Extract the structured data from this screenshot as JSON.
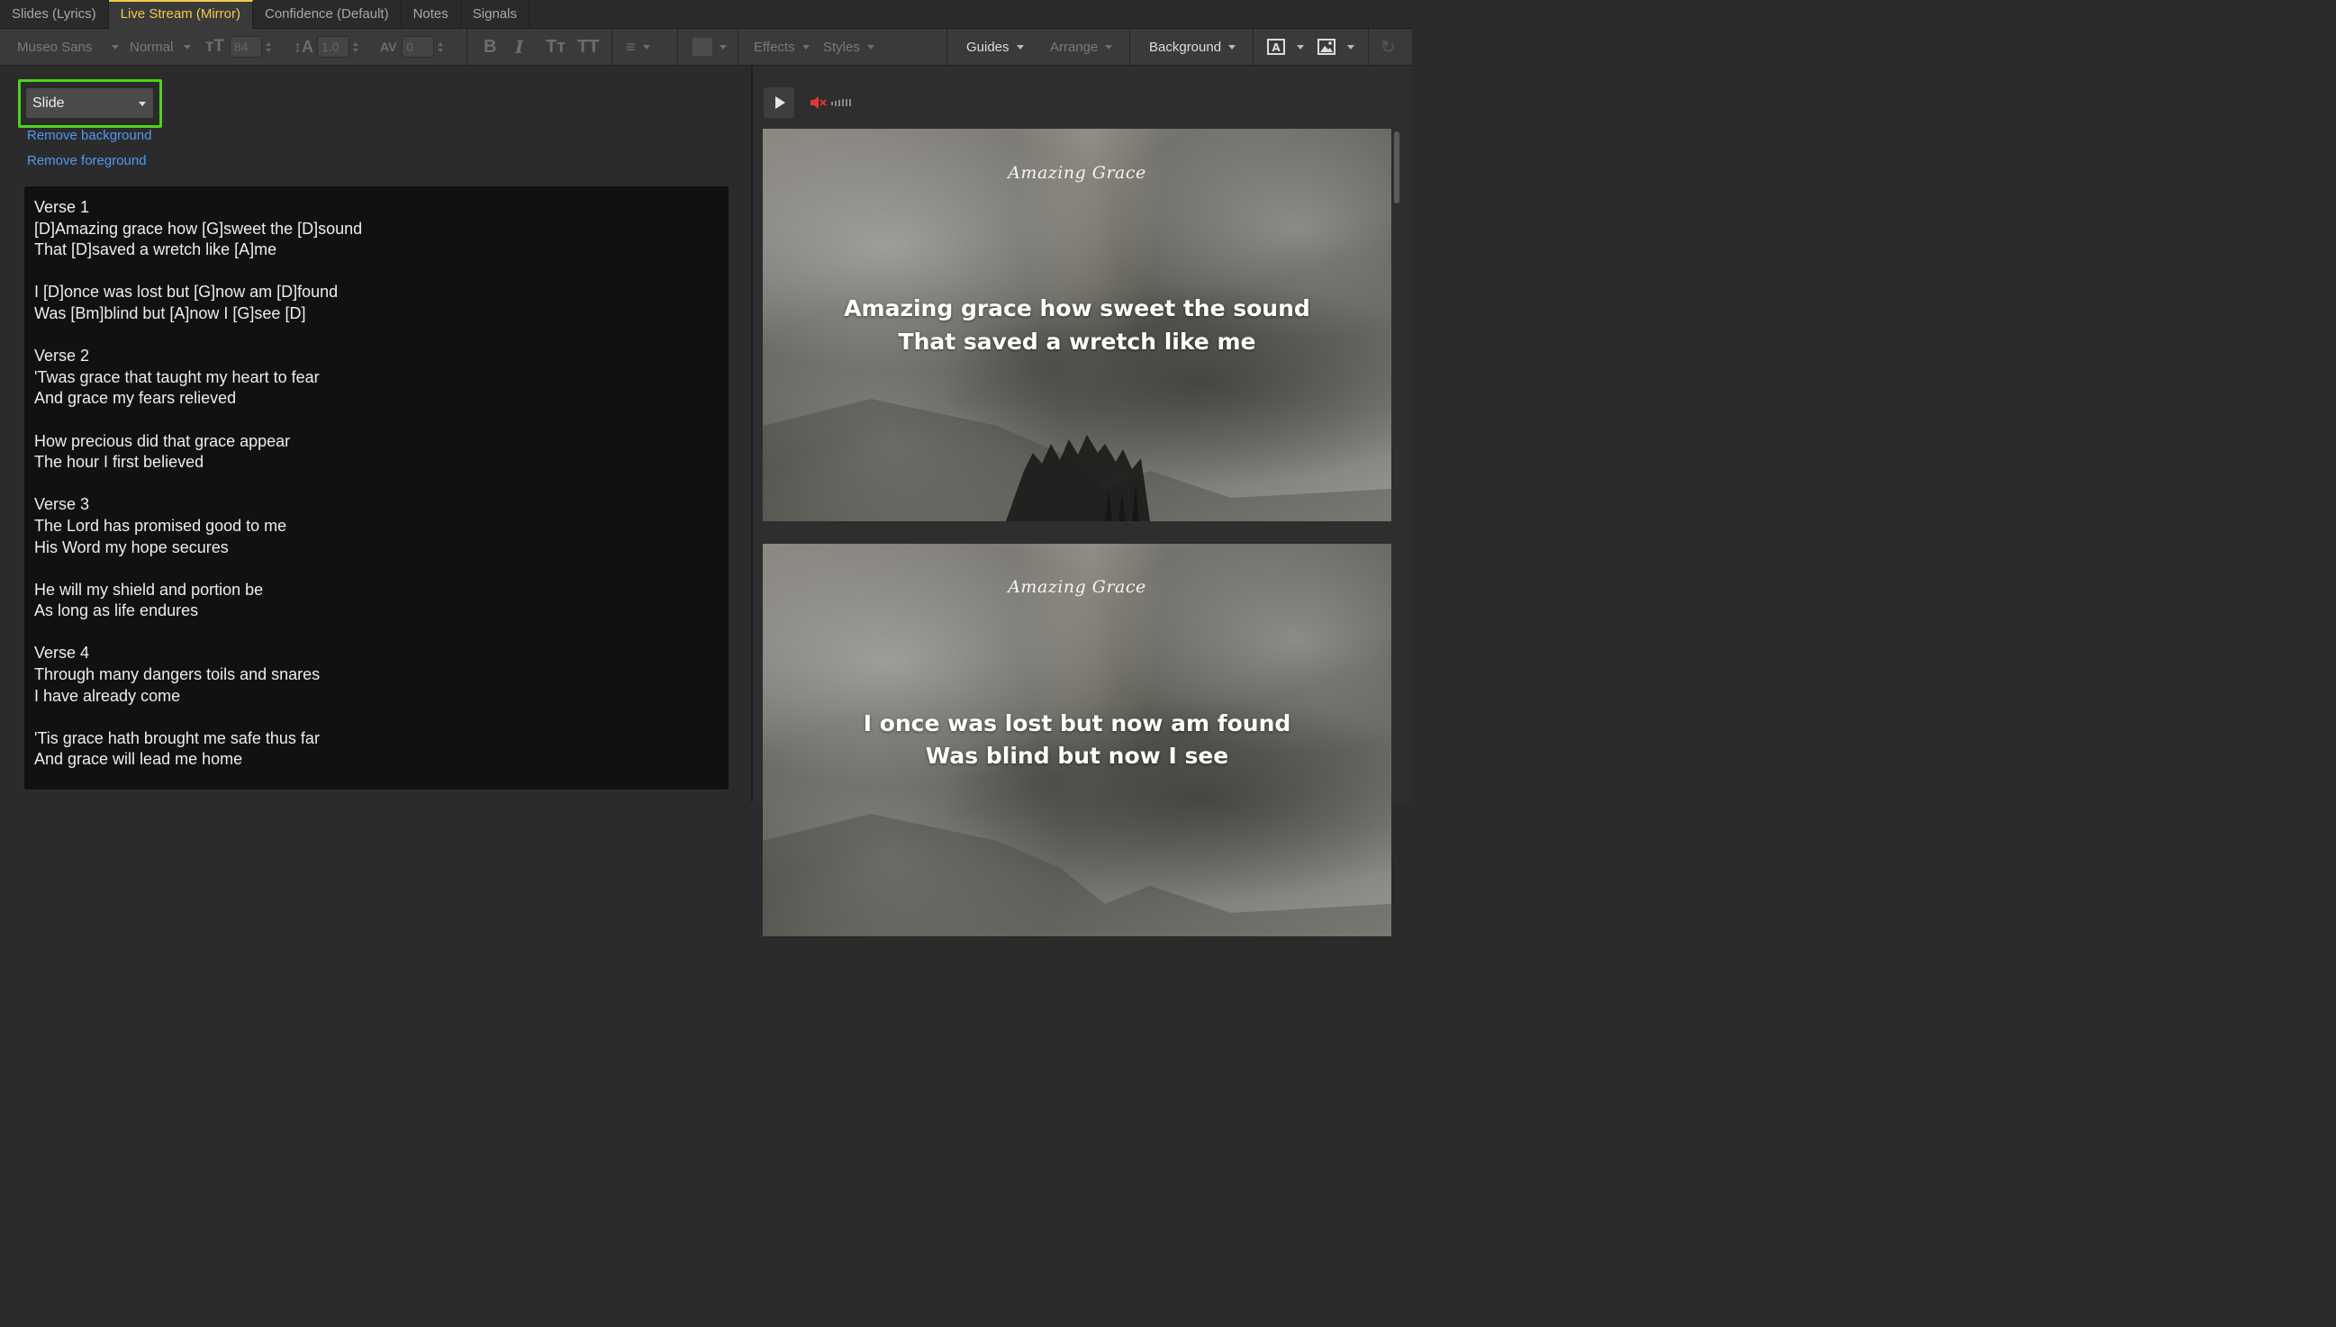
{
  "tabs": [
    {
      "label": "Slides (Lyrics)",
      "active": false
    },
    {
      "label": "Live Stream (Mirror)",
      "active": true
    },
    {
      "label": "Confidence (Default)",
      "active": false
    },
    {
      "label": "Notes",
      "active": false
    },
    {
      "label": "Signals",
      "active": false
    }
  ],
  "toolbar": {
    "font_family": "Museo Sans",
    "font_weight": "Normal",
    "font_size": "84",
    "line_height": "1.0",
    "letter_spacing": "0",
    "effects": "Effects",
    "styles": "Styles",
    "guides": "Guides",
    "arrange": "Arrange",
    "background": "Background"
  },
  "left": {
    "layer_select": "Slide",
    "remove_background": "Remove background",
    "remove_foreground": "Remove foreground",
    "lyrics": [
      "Verse 1",
      "[D]Amazing grace how [G]sweet the [D]sound",
      "That [D]saved a wretch like [A]me",
      "",
      "I [D]once was lost but [G]now am [D]found",
      "Was [Bm]blind but [A]now I [G]see [D]",
      "",
      "Verse 2",
      "'Twas grace that taught my heart to fear",
      "And grace my fears relieved",
      "",
      "How precious did that grace appear",
      "The hour I first believed",
      "",
      "Verse 3",
      "The Lord has promised good to me",
      "His Word my hope secures",
      "",
      "He will my shield and portion be",
      "As long as life endures",
      "",
      "Verse 4",
      "Through many dangers toils and snares",
      "I have already come",
      "",
      "'Tis grace hath brought me safe thus far",
      "And grace will lead me home"
    ]
  },
  "preview": {
    "slides": [
      {
        "title": "Amazing Grace",
        "line1": "Amazing grace how sweet the sound",
        "line2": "That saved a wretch like me"
      },
      {
        "title": "Amazing Grace",
        "line1": "I once was lost but now am found",
        "line2": "Was blind but now I see"
      }
    ]
  },
  "colors": {
    "active_tab": "#f2c94c",
    "link": "#4c9bf0",
    "highlight": "#4cd41c",
    "mute_icon": "#e03a2f"
  }
}
